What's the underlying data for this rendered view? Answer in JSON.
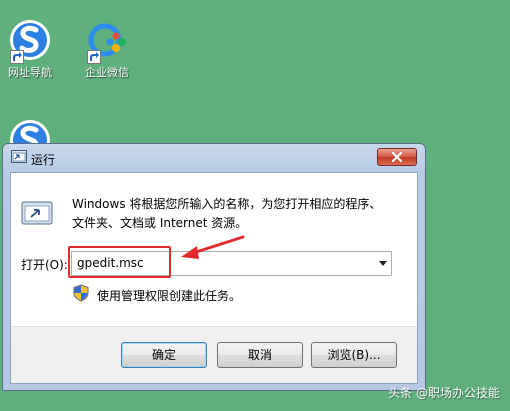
{
  "desktop": {
    "icons": [
      {
        "label": "网址导航"
      },
      {
        "label": "企业微信"
      },
      {
        "label": ""
      }
    ]
  },
  "dialog": {
    "title": "运行",
    "description_line1": "Windows 将根据您所输入的名称，为您打开相应的程序、",
    "description_line2": "文件夹、文档或 Internet 资源。",
    "open_label": "打开(O):",
    "input_value": "gpedit.msc",
    "admin_note": "使用管理权限创建此任务。",
    "buttons": {
      "ok": "确定",
      "cancel": "取消",
      "browse": "浏览(B)..."
    }
  },
  "watermark": "头条 @职场办公技能",
  "colors": {
    "desktop_bg": "#5fb07c",
    "annotation_red": "#e22b2b",
    "close_red": "#c23b22"
  }
}
